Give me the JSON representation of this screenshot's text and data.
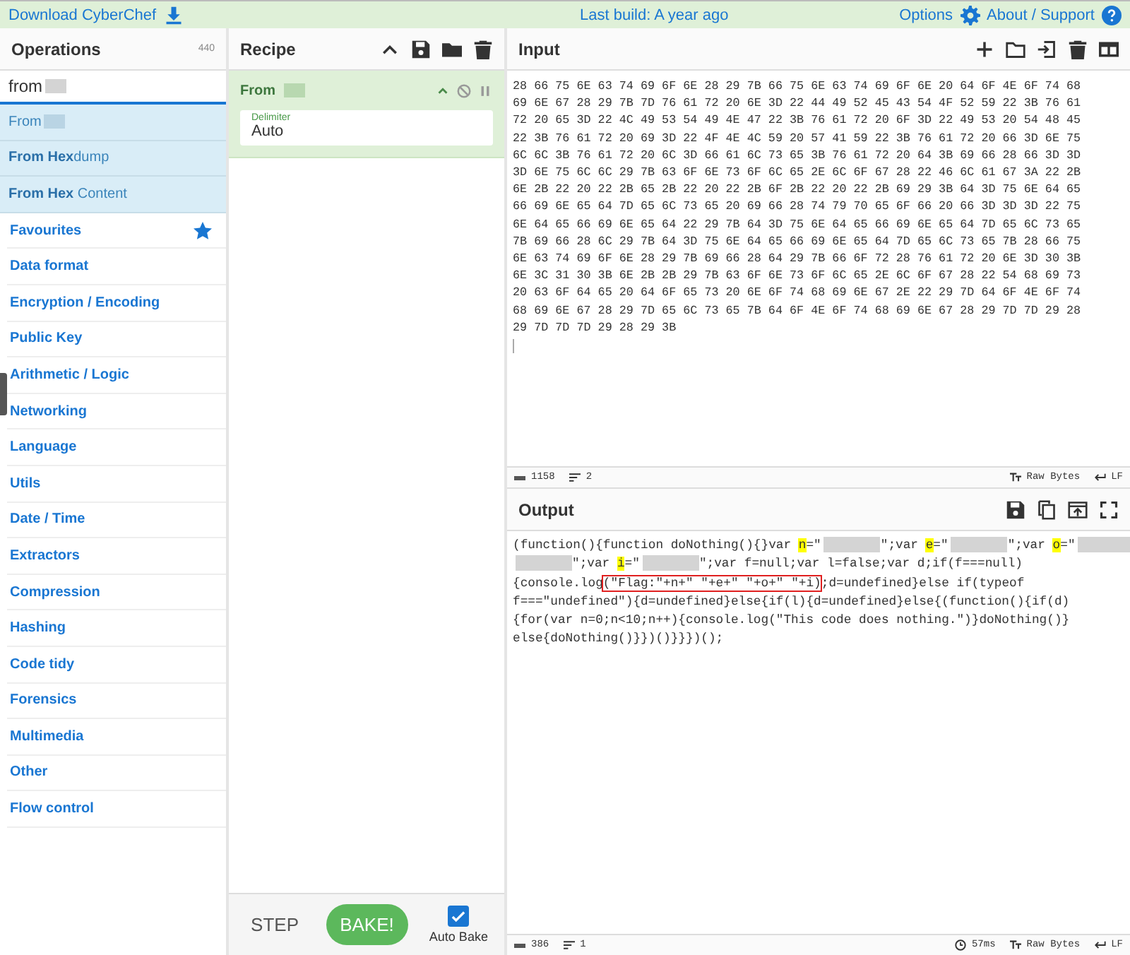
{
  "top_bar": {
    "download": "Download CyberChef",
    "build": "Last build: A year ago",
    "options": "Options",
    "about": "About / Support"
  },
  "operations": {
    "title": "Operations",
    "count": "440",
    "search": {
      "value": "from",
      "redacted": true
    },
    "results": [
      {
        "label": "From",
        "redacted": true
      },
      {
        "label": "**From Hex**dump",
        "redacted": false
      },
      {
        "label": "**From Hex** Content",
        "redacted": false
      }
    ],
    "categories": [
      {
        "label": "Favourites",
        "kind": "favourites"
      },
      {
        "label": "Data format",
        "kind": "category"
      },
      {
        "label": "Encryption / Encoding",
        "kind": "category"
      },
      {
        "label": "Public Key",
        "kind": "category"
      },
      {
        "label": "Arithmetic / Logic",
        "kind": "category"
      },
      {
        "label": "Networking",
        "kind": "category"
      },
      {
        "label": "Language",
        "kind": "category"
      },
      {
        "label": "Utils",
        "kind": "category"
      },
      {
        "label": "Date / Time",
        "kind": "category"
      },
      {
        "label": "Extractors",
        "kind": "category"
      },
      {
        "label": "Compression",
        "kind": "category"
      },
      {
        "label": "Hashing",
        "kind": "category"
      },
      {
        "label": "Code tidy",
        "kind": "category"
      },
      {
        "label": "Forensics",
        "kind": "category"
      },
      {
        "label": "Multimedia",
        "kind": "category"
      },
      {
        "label": "Other",
        "kind": "category"
      },
      {
        "label": "Flow control",
        "kind": "category"
      }
    ]
  },
  "recipe": {
    "title": "Recipe",
    "ingredient": {
      "name": "From",
      "redacted": true,
      "field_label": "Delimiter",
      "field_value": "Auto"
    },
    "step": "STEP",
    "bake": "BAKE!",
    "auto_bake": {
      "label": "Auto Bake",
      "checked": true
    }
  },
  "input": {
    "title": "Input",
    "lines": [
      "28 66 75 6E 63 74 69 6F 6E 28 29 7B 66 75 6E 63 74 69 6F 6E 20 64 6F 4E 6F 74 68",
      "69 6E 67 28 29 7B 7D 76 61 72 20 6E 3D 22 44 49 52 45 43 54 4F 52 59 22 3B 76 61",
      "72 20 65 3D 22 4C 49 53 54 49 4E 47 22 3B 76 61 72 20 6F 3D 22 49 53 20 54 48 45",
      "22 3B 76 61 72 20 69 3D 22 4F 4E 4C 59 20 57 41 59 22 3B 76 61 72 20 66 3D 6E 75",
      "6C 6C 3B 76 61 72 20 6C 3D 66 61 6C 73 65 3B 76 61 72 20 64 3B 69 66 28 66 3D 3D",
      "3D 6E 75 6C 6C 29 7B 63 6F 6E 73 6F 6C 65 2E 6C 6F 67 28 22 46 6C 61 67 3A 22 2B",
      "6E 2B 22 20 22 2B 65 2B 22 20 22 2B 6F 2B 22 20 22 2B 69 29 3B 64 3D 75 6E 64 65",
      "66 69 6E 65 64 7D 65 6C 73 65 20 69 66 28 74 79 70 65 6F 66 20 66 3D 3D 3D 22 75",
      "6E 64 65 66 69 6E 65 64 22 29 7B 64 3D 75 6E 64 65 66 69 6E 65 64 7D 65 6C 73 65",
      "7B 69 66 28 6C 29 7B 64 3D 75 6E 64 65 66 69 6E 65 64 7D 65 6C 73 65 7B 28 66 75",
      "6E 63 74 69 6F 6E 28 29 7B 69 66 28 64 29 7B 66 6F 72 28 76 61 72 20 6E 3D 30 3B",
      "6E 3C 31 30 3B 6E 2B 2B 29 7B 63 6F 6E 73 6F 6C 65 2E 6C 6F 67 28 22 54 68 69 73",
      "20 63 6F 64 65 20 64 6F 65 73 20 6E 6F 74 68 69 6E 67 2E 22 29 7D 64 6F 4E 6F 74",
      "68 69 6E 67 28 29 7D 65 6C 73 65 7B 64 6F 4E 6F 74 68 69 6E 67 28 29 7D 7D 29 28",
      "29 7D 7D 7D 29 28 29 3B"
    ],
    "status": {
      "length": "1158",
      "lines": "2",
      "format": "Raw Bytes",
      "eol": "LF"
    }
  },
  "output": {
    "title": "Output",
    "lines": [
      [
        {
          "kind": "text",
          "text": "(function(){function doNothing(){}var "
        },
        {
          "kind": "mark",
          "text": "n"
        },
        {
          "kind": "text",
          "text": "=\""
        },
        {
          "kind": "redacted"
        },
        {
          "kind": "text",
          "text": "\";var "
        },
        {
          "kind": "mark",
          "text": "e"
        },
        {
          "kind": "text",
          "text": "=\""
        },
        {
          "kind": "redacted"
        },
        {
          "kind": "text",
          "text": "\";var "
        },
        {
          "kind": "mark",
          "text": "o"
        },
        {
          "kind": "text",
          "text": "=\""
        },
        {
          "kind": "redacted"
        }
      ],
      [
        {
          "kind": "redacted"
        },
        {
          "kind": "text",
          "text": "\";var "
        },
        {
          "kind": "mark",
          "text": "i"
        },
        {
          "kind": "text",
          "text": "=\""
        },
        {
          "kind": "redacted"
        },
        {
          "kind": "text",
          "text": "\";var f=null;var l=false;var d;if(f===null)"
        }
      ],
      [
        {
          "kind": "text",
          "text": "{console.log"
        },
        {
          "kind": "boxed",
          "text": "(\"Flag:\"+n+\" \"+e+\" \"+o+\" \"+i)"
        },
        {
          "kind": "text",
          "text": ";d=undefined}else if(typeof"
        }
      ],
      [
        {
          "kind": "text",
          "text": "f===\"undefined\"){d=undefined}else{if(l){d=undefined}else{(function(){if(d)"
        }
      ],
      [
        {
          "kind": "text",
          "text": "{for(var n=0;n<10;n++){console.log(\"This code does nothing.\")}doNothing()}"
        }
      ],
      [
        {
          "kind": "text",
          "text": "else{doNothing()}})()}}})();"
        }
      ]
    ],
    "status": {
      "length": "386",
      "lines": "1",
      "time": "57ms",
      "format": "Raw Bytes",
      "eol": "LF"
    }
  }
}
